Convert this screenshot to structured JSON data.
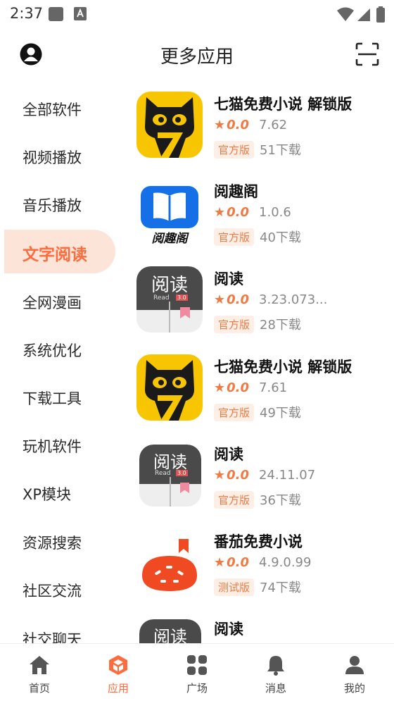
{
  "status_bar": {
    "time": "2:37"
  },
  "header": {
    "title": "更多应用",
    "avatar_icon": "user-circle-icon",
    "scan_icon": "scan-icon"
  },
  "sidebar": {
    "active_index": 3,
    "items": [
      {
        "label": "全部软件"
      },
      {
        "label": "视频播放"
      },
      {
        "label": "音乐播放"
      },
      {
        "label": "文字阅读"
      },
      {
        "label": "全网漫画"
      },
      {
        "label": "系统优化"
      },
      {
        "label": "下载工具"
      },
      {
        "label": "玩机软件"
      },
      {
        "label": "XP模块"
      },
      {
        "label": "资源搜索"
      },
      {
        "label": "社区交流"
      },
      {
        "label": "社交聊天"
      }
    ]
  },
  "apps": [
    {
      "name": "七猫免费小说 解锁版",
      "rating": "0.0",
      "version": "7.62",
      "tag": "官方版",
      "downloads": "51下载",
      "icon": "qimao-icon"
    },
    {
      "name": "阅趣阁",
      "rating": "0.0",
      "version": "1.0.6",
      "tag": "官方版",
      "downloads": "40下载",
      "icon": "yuequge-icon",
      "icon_text": "阅趣阁"
    },
    {
      "name": "阅读",
      "rating": "0.0",
      "version": "3.23.073...",
      "tag": "官方版",
      "downloads": "28下载",
      "icon": "yuedu-icon",
      "icon_text": "阅读",
      "icon_sub": "Read",
      "icon_ver": "3.0"
    },
    {
      "name": "七猫免费小说 解锁版",
      "rating": "0.0",
      "version": "7.61",
      "tag": "官方版",
      "downloads": "49下载",
      "icon": "qimao-icon"
    },
    {
      "name": "阅读",
      "rating": "0.0",
      "version": "24.11.07",
      "tag": "官方版",
      "downloads": "36下载",
      "icon": "yuedu-icon",
      "icon_text": "阅读",
      "icon_sub": "Read",
      "icon_ver": "3.0"
    },
    {
      "name": "番茄免费小说",
      "rating": "0.0",
      "version": "4.9.0.99",
      "tag": "测试版",
      "downloads": "74下载",
      "icon": "fanqie-icon"
    },
    {
      "name": "阅读",
      "icon": "yuedu-icon",
      "icon_text": "阅读"
    }
  ],
  "bottom_nav": {
    "active_index": 1,
    "items": [
      {
        "label": "首页",
        "icon": "home-icon"
      },
      {
        "label": "应用",
        "icon": "apps-cube-icon"
      },
      {
        "label": "广场",
        "icon": "grid-icon"
      },
      {
        "label": "消息",
        "icon": "bell-icon"
      },
      {
        "label": "我的",
        "icon": "person-icon"
      }
    ]
  },
  "colors": {
    "accent": "#ff6b3d",
    "accent_bg": "#fde4d8",
    "star": "#f07a42",
    "qimao_yellow": "#f7c600",
    "yuequge_blue": "#1570e8",
    "fanqie_red": "#f04a22"
  }
}
